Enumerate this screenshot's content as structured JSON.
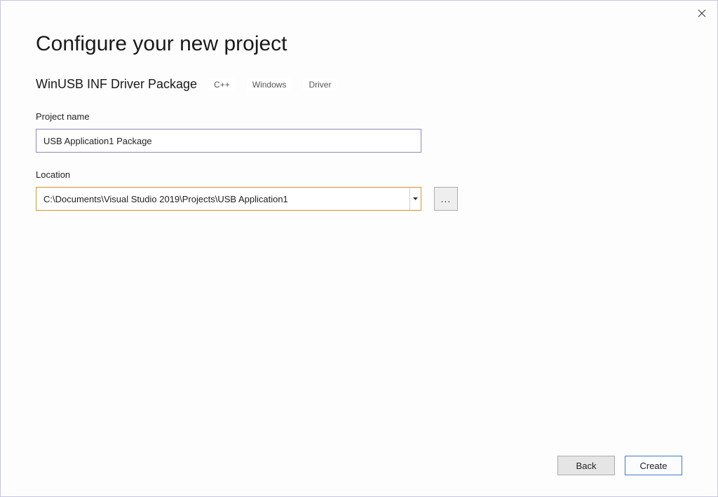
{
  "heading": "Configure your new project",
  "template": {
    "name": "WinUSB INF Driver Package",
    "tags": [
      "C++",
      "Windows",
      "Driver"
    ]
  },
  "fields": {
    "project_name": {
      "label": "Project name",
      "value": "USB Application1 Package"
    },
    "location": {
      "label": "Location",
      "value": "C:\\Documents\\Visual Studio 2019\\Projects\\USB Application1",
      "browse_label": "..."
    }
  },
  "buttons": {
    "back": "Back",
    "create": "Create"
  }
}
